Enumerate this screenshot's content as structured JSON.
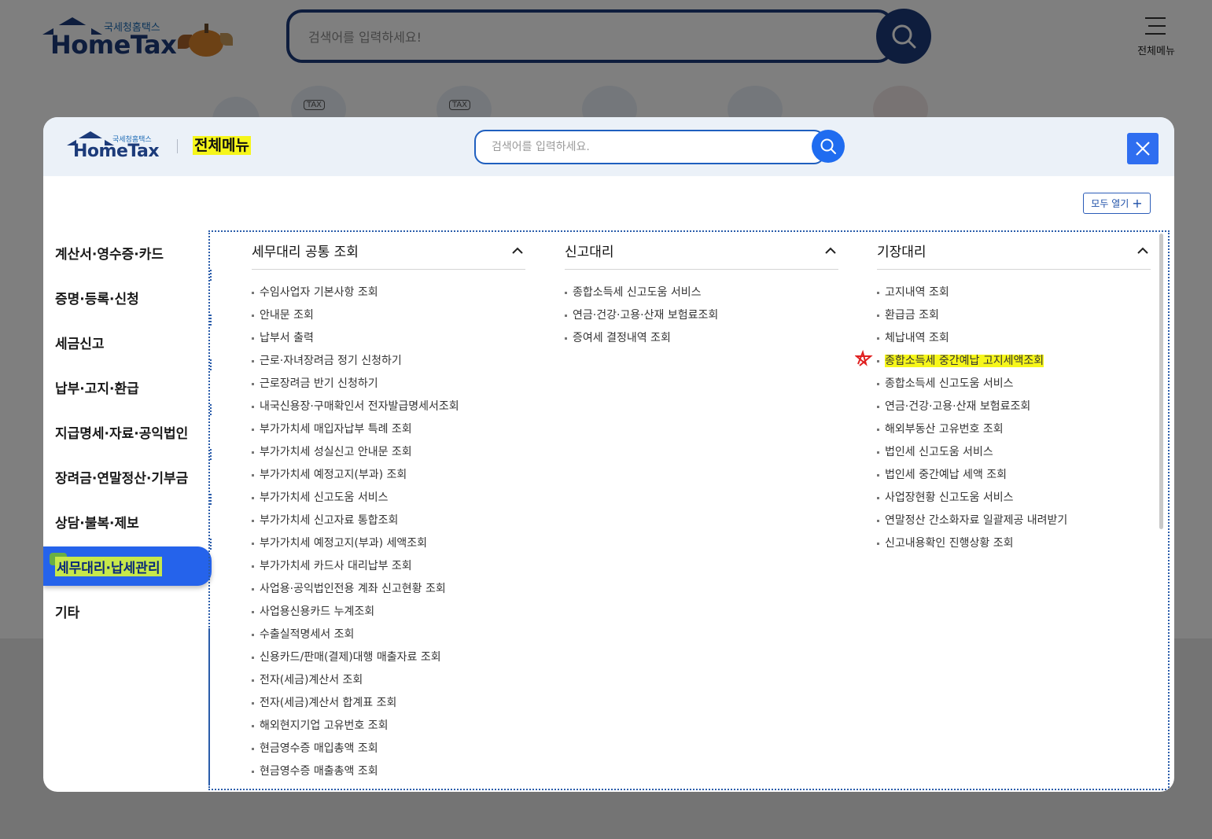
{
  "background": {
    "logo": {
      "sub": "국세청홈택스",
      "main": "HomeTax"
    },
    "search": {
      "placeholder": "검색어를 입력하세요!"
    },
    "all_menu_label": "전체메뉴",
    "icon_label": "TAX"
  },
  "modal": {
    "logo": {
      "sub": "국세청홈택스",
      "main": "HomeTax"
    },
    "title": "전체메뉴",
    "search": {
      "placeholder": "검색어를 입력하세요."
    },
    "open_all_label": "모두 열기",
    "open_all_icon": "+",
    "nav": [
      {
        "label": "계산서·영수증·카드",
        "active": false
      },
      {
        "label": "증명·등록·신청",
        "active": false
      },
      {
        "label": "세금신고",
        "active": false
      },
      {
        "label": "납부·고지·환급",
        "active": false
      },
      {
        "label": "지급명세·자료·공익법인",
        "active": false
      },
      {
        "label": "장려금·연말정산·기부금",
        "active": false
      },
      {
        "label": "상담·불복·제보",
        "active": false
      },
      {
        "label": "세무대리·납세관리",
        "active": true
      },
      {
        "label": "기타",
        "active": false
      }
    ],
    "columns": [
      {
        "title": "세무대리 공통 조회",
        "items": [
          "수임사업자 기본사항 조회",
          "안내문 조회",
          "납부서 출력",
          "근로·자녀장려금 정기 신청하기",
          "근로장려금 반기 신청하기",
          "내국신용장·구매확인서 전자발급명세서조회",
          "부가가치세 매입자납부 특례 조회",
          "부가가치세 성실신고 안내문 조회",
          "부가가치세 예정고지(부과) 조회",
          "부가가치세 신고도움 서비스",
          "부가가치세 신고자료 통합조회",
          "부가가치세 예정고지(부과) 세액조회",
          "부가가치세 카드사 대리납부 조회",
          "사업용·공익법인전용 계좌 신고현황 조회",
          "사업용신용카드 누계조회",
          "수출실적명세서 조회",
          "신용카드/판매(결제)대행 매출자료 조회",
          "전자(세금)계산서 조회",
          "전자(세금)계산서 합계표 조회",
          "해외현지기업 고유번호 조회",
          "현금영수증 매입총액 조회",
          "현금영수증 매출총액 조회"
        ]
      },
      {
        "title": "신고대리",
        "items": [
          "종합소득세 신고도움 서비스",
          "연금·건강·고용·산재 보험료조회",
          "증여세 결정내역 조회"
        ]
      },
      {
        "title": "기장대리",
        "items": [
          "고지내역 조회",
          "환급금 조회",
          "체납내역 조회",
          "종합소득세 중간예납 고지세액조회",
          "종합소득세 신고도움 서비스",
          "연금·건강·고용·산재 보험료조회",
          "해외부동산 고유번호 조회",
          "법인세 신고도움 서비스",
          "법인세 중간예납 세액 조회",
          "사업장현황 신고도움 서비스",
          "연말정산 간소화자료 일괄제공 내려받기",
          "신고내용확인 진행상황 조회"
        ]
      }
    ],
    "highlighted_item": "종합소득세 중간예납 고지세액조회"
  },
  "colors": {
    "brand_navy": "#1c3b7a",
    "accent_blue": "#2563eb",
    "highlight_yellow": "#f6f61a",
    "annotation_red": "#e02020"
  }
}
